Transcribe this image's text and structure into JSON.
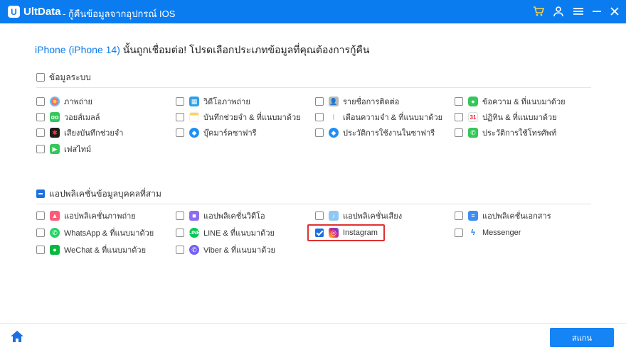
{
  "titlebar": {
    "app_name": "UltData",
    "subtitle": "-  กู้คืนข้อมูลจากอุปกรณ์ IOS",
    "bg": "#0a7cf0",
    "icons": [
      "cart-icon",
      "user-icon",
      "menu-icon",
      "minimize-icon",
      "close-icon"
    ]
  },
  "heading": {
    "device": "iPhone (iPhone 14)",
    "text": " นั้นถูกเชื่อมต่อ! โปรดเลือกประเภทข้อมูลที่คุณต้องการกู้คืน"
  },
  "system_section": {
    "title": "ข้อมูลระบบ",
    "state": "unchecked",
    "items": [
      {
        "label": "ภาพถ่าย",
        "icon": "photos-icon",
        "checked": false
      },
      {
        "label": "วิดีโอภาพถ่าย",
        "icon": "video-icon",
        "checked": false
      },
      {
        "label": "รายชื่อการติดต่อ",
        "icon": "contacts-icon",
        "checked": false
      },
      {
        "label": "ข้อความ & ที่แนบมาด้วย",
        "icon": "messages-icon",
        "checked": false
      },
      {
        "label": "วอยส์เมลล์",
        "icon": "voicemail-icon",
        "checked": false
      },
      {
        "label": "บันทึกช่วยจำ  & ที่แนบมาด้วย",
        "icon": "notes-icon",
        "checked": false
      },
      {
        "label": "เตือนความจำ  & ที่แนบมาด้วย",
        "icon": "reminders-icon",
        "checked": false
      },
      {
        "label": "ปฏิทิน & ที่แนบมาด้วย",
        "icon": "calendar-icon",
        "checked": false
      },
      {
        "label": "เสียงบันทึกช่วยจำ",
        "icon": "voice-memo-icon",
        "checked": false
      },
      {
        "label": "บุ๊คมาร์คซาฟารี",
        "icon": "safari-icon",
        "checked": false
      },
      {
        "label": "ประวัติการใช้งานในซาฟารี",
        "icon": "safari-history-icon",
        "checked": false
      },
      {
        "label": "ประวัติการใช้โทรศัพท์",
        "icon": "phone-icon",
        "checked": false
      },
      {
        "label": "เฟสไทม์",
        "icon": "facetime-icon",
        "checked": false
      }
    ]
  },
  "thirdparty_section": {
    "title": "แอปพลิเคชั่นข้อมูลบุคคลที่สาม",
    "state": "partial",
    "items": [
      {
        "label": "แอปพลิเคชั่นภาพถ่าย",
        "icon": "app-photos-icon",
        "checked": false
      },
      {
        "label": "แอปพลิเคชั่นวิดีโอ",
        "icon": "app-video-icon",
        "checked": false
      },
      {
        "label": "แอปพลิเคชั่นเสียง",
        "icon": "app-audio-icon",
        "checked": false
      },
      {
        "label": "แอปพลิเคชั่นเอกสาร",
        "icon": "app-document-icon",
        "checked": false
      },
      {
        "label": "WhatsApp & ที่แนบมาด้วย",
        "icon": "whatsapp-icon",
        "checked": false
      },
      {
        "label": "LINE & ที่แนบมาด้วย",
        "icon": "line-icon",
        "checked": false
      },
      {
        "label": "Instagram",
        "icon": "instagram-icon",
        "checked": true
      },
      {
        "label": "Messenger",
        "icon": "messenger-icon",
        "checked": false
      },
      {
        "label": "WeChat & ที่แนบมาด้วย",
        "icon": "wechat-icon",
        "checked": false
      },
      {
        "label": "Viber & ที่แนบมาด้วย",
        "icon": "viber-icon",
        "checked": false
      }
    ]
  },
  "footer": {
    "scan_label": "สแกน",
    "accent": "#1584f5"
  }
}
